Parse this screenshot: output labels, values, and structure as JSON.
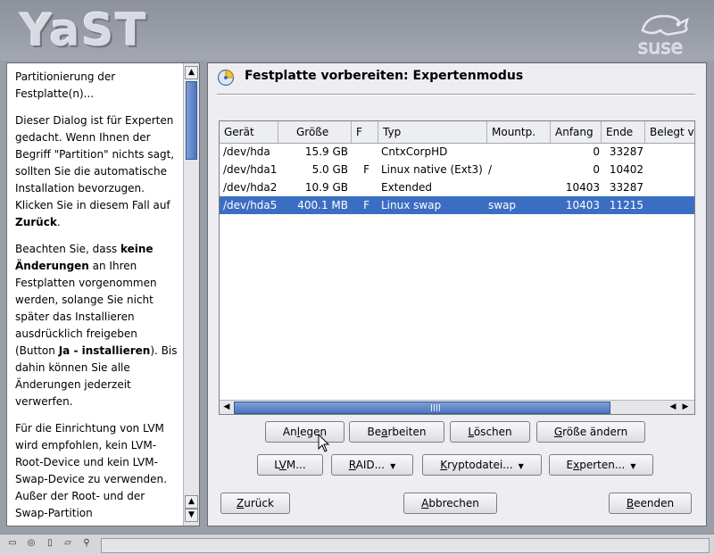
{
  "app": {
    "logo_text": "YaST",
    "brand_logo_text": "suse"
  },
  "help": {
    "paragraphs": [
      {
        "text": "Partitionierung der Festplatte(n)..."
      },
      {
        "pre": "Dieser Dialog ist für Experten gedacht. Wenn Ihnen der Begriff \"Partition\" nichts sagt, sollten Sie die automatische Installation bevorzugen. Klicken Sie in diesem Fall auf ",
        "bold": "Zurück",
        "post": "."
      },
      {
        "pre": "Beachten Sie, dass ",
        "bold": "keine Änderungen",
        "post": " an Ihren Festplatten vorgenommen werden, solange Sie nicht später das Installieren ausdrücklich freigeben (Button ",
        "bold2": "Ja - installieren",
        "post2": "). Bis dahin können Sie alle Änderungen jederzeit verwerfen."
      },
      {
        "text": "Für die Einrichtung von LVM wird empfohlen, kein LVM-Root-Device und kein LVM-Swap-Device zu verwenden. Außer der Root- und der Swap-Partition"
      }
    ]
  },
  "dialog": {
    "title": "Festplatte vorbereiten: Expertenmodus",
    "columns": [
      "Gerät",
      "Größe",
      "F",
      "Typ",
      "Mountp.",
      "Anfang",
      "Ende",
      "Belegt v"
    ],
    "rows": [
      {
        "device": "/dev/hda",
        "size": "15.9 GB",
        "f": "",
        "type": "CntxCorpHD",
        "mount": "",
        "start": "0",
        "end": "33287",
        "selected": false
      },
      {
        "device": "/dev/hda1",
        "size": "5.0 GB",
        "f": "F",
        "type": "Linux native (Ext3)",
        "mount": "/",
        "start": "0",
        "end": "10402",
        "selected": false
      },
      {
        "device": "/dev/hda2",
        "size": "10.9 GB",
        "f": "",
        "type": "Extended",
        "mount": "",
        "start": "10403",
        "end": "33287",
        "selected": false
      },
      {
        "device": "/dev/hda5",
        "size": "400.1 MB",
        "f": "F",
        "type": "Linux swap",
        "mount": "swap",
        "start": "10403",
        "end": "11215",
        "selected": true
      }
    ],
    "buttons_row1": [
      {
        "pre": "An",
        "ul": "l",
        "post": "egen"
      },
      {
        "pre": "Be",
        "ul": "a",
        "post": "rbeiten"
      },
      {
        "pre": "",
        "ul": "L",
        "post": "öschen"
      },
      {
        "pre": "",
        "ul": "G",
        "post": "röße ändern"
      }
    ],
    "buttons_row2": [
      {
        "pre": "L",
        "ul": "V",
        "post": "M..."
      },
      {
        "pre": "",
        "ul": "R",
        "post": "AID..."
      },
      {
        "pre": "",
        "ul": "K",
        "post": "ryptodatei..."
      },
      {
        "pre": "E",
        "ul": "x",
        "post": "perten..."
      }
    ],
    "nav": {
      "back": {
        "pre": "",
        "ul": "Z",
        "post": "urück"
      },
      "abort": {
        "pre": "",
        "ul": "A",
        "post": "bbrechen"
      },
      "finish": {
        "pre": "",
        "ul": "B",
        "post": "eenden"
      }
    }
  },
  "colors": {
    "selection": "#3b6ec3",
    "panel_bg": "#eeeef2",
    "desktop": "#9a9ea8"
  }
}
